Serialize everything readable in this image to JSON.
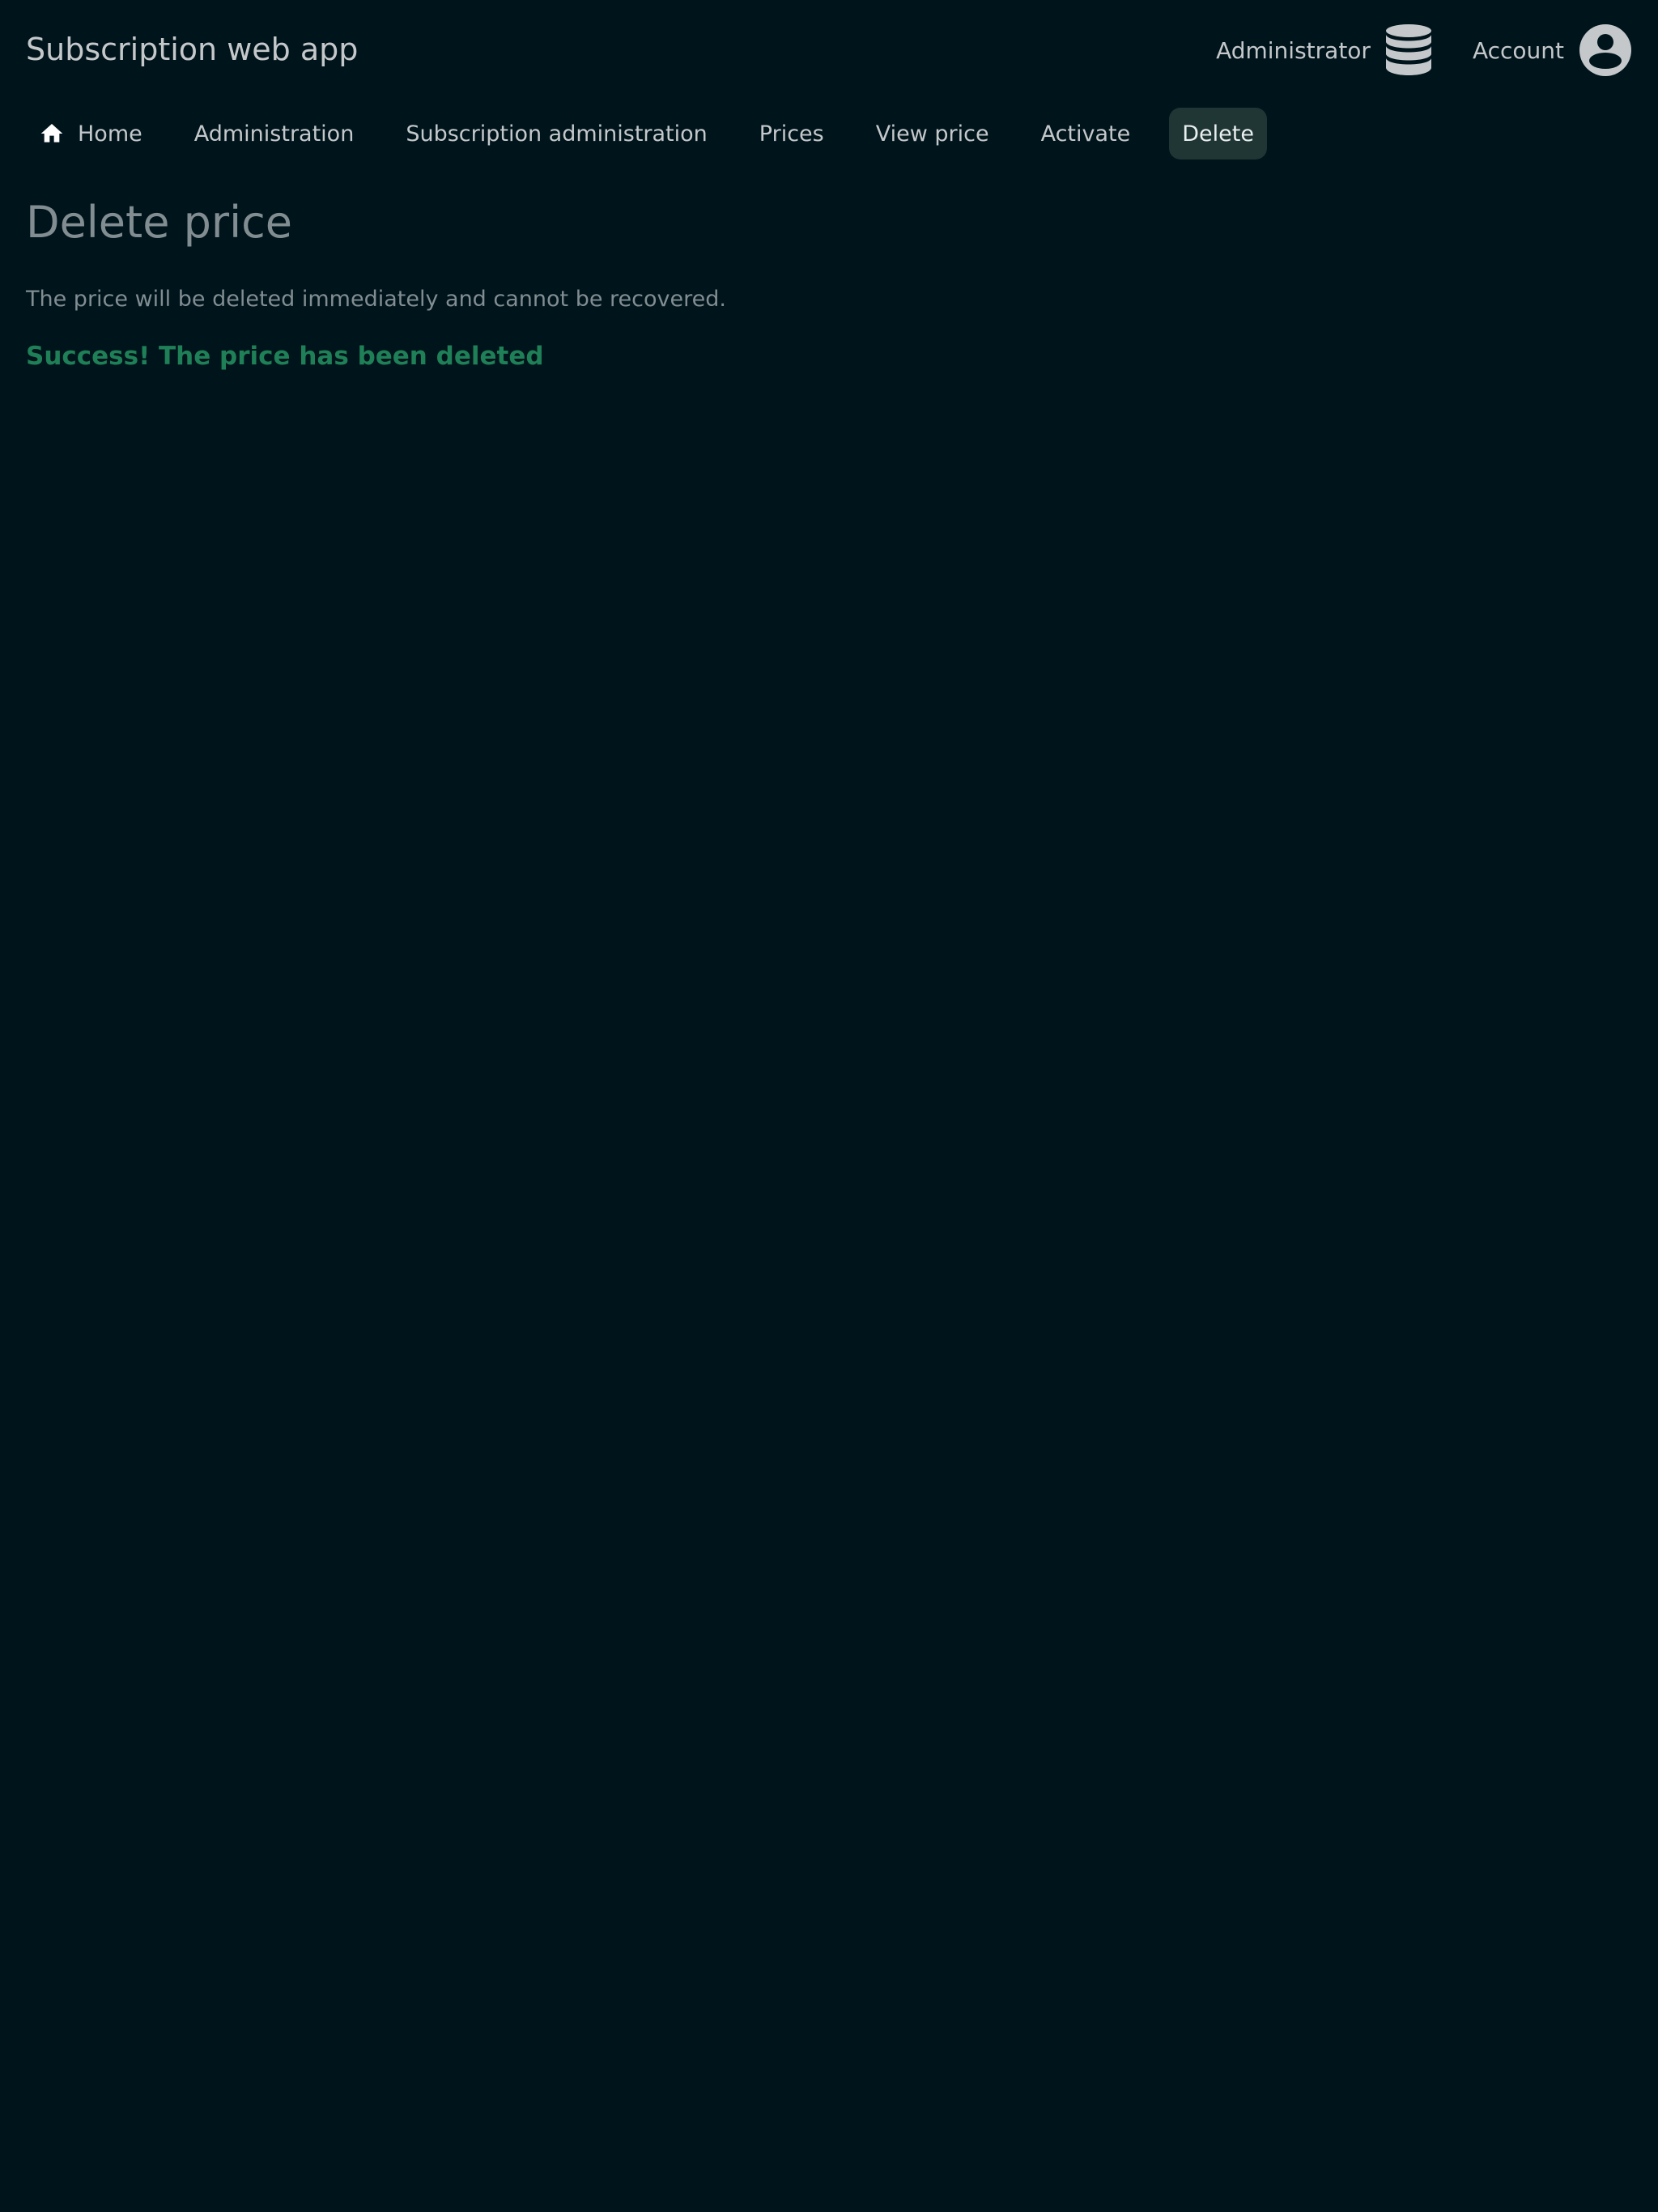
{
  "header": {
    "app_title": "Subscription web app",
    "administrator_label": "Administrator",
    "account_label": "Account",
    "administrator_icon": "database-icon",
    "account_icon": "account-circle-icon"
  },
  "nav": {
    "home_icon": "home-icon",
    "items": [
      {
        "label": "Home"
      },
      {
        "label": "Administration"
      },
      {
        "label": "Subscription administration"
      },
      {
        "label": "Prices"
      },
      {
        "label": "View price"
      },
      {
        "label": "Activate"
      },
      {
        "label": "Delete",
        "active": true
      }
    ]
  },
  "main": {
    "title": "Delete price",
    "description": "The price will be deleted immediately and cannot be recovered.",
    "success_message": "Success! The price has been deleted"
  },
  "colors": {
    "background": "#00141b",
    "text": "#c4c8ca",
    "muted_text": "#818d91",
    "active_nav_bg": "#1f3634",
    "success": "#1f7f57"
  }
}
